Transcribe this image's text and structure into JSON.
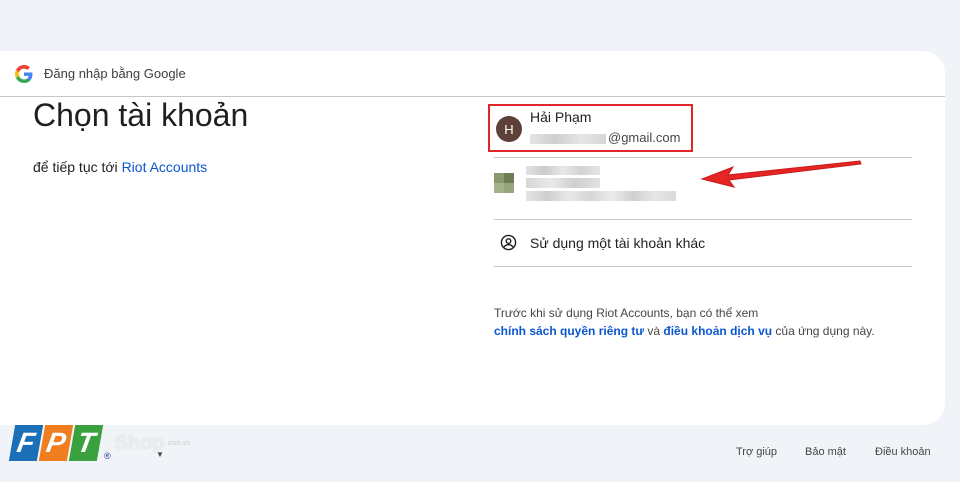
{
  "header": {
    "title": "Đăng nhập bằng Google",
    "icon": "google-g-icon"
  },
  "main": {
    "title": "Chọn tài khoản",
    "subtitle_prefix": "để tiếp tục tới ",
    "subtitle_link": "Riot Accounts"
  },
  "accounts": [
    {
      "initial": "H",
      "name": "Hải Phạm",
      "email_suffix": "@gmail.com"
    }
  ],
  "other_account": {
    "label": "Sử dụng một tài khoản khác",
    "icon": "account-circle-icon"
  },
  "notice": {
    "line1": "Trước khi sử dụng Riot Accounts, bạn có thể xem",
    "privacy_link": "chính sách quyền riêng tư",
    "conjunction": " và ",
    "terms_link": "điều khoản dịch vụ",
    "suffix": " của ứng dụng này."
  },
  "footer": {
    "help": "Trợ giúp",
    "privacy": "Bảo mật",
    "terms": "Điều khoản"
  },
  "watermark": {
    "brand": "FPT",
    "shop": "Shop",
    "domain": ".com.vn"
  },
  "colors": {
    "link": "#0b57d0",
    "highlight": "#e0252b",
    "avatar": "#5d4037"
  }
}
